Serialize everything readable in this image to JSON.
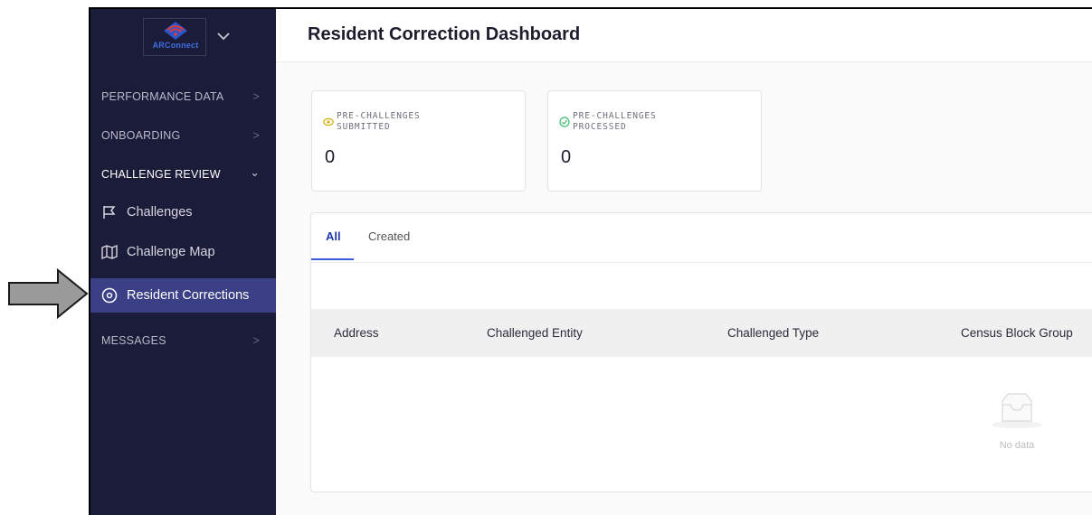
{
  "logo": {
    "text": "ARConnect"
  },
  "sidebar": {
    "sections": {
      "performance": {
        "label": "PERFORMANCE DATA",
        "chevron": ">"
      },
      "onboarding": {
        "label": "ONBOARDING",
        "chevron": ">"
      },
      "challenge_review": {
        "label": "CHALLENGE REVIEW",
        "chevron": "⌄"
      },
      "messages": {
        "label": "MESSAGES",
        "chevron": ">"
      }
    },
    "items": [
      {
        "label": "Challenges",
        "icon": "flag-icon"
      },
      {
        "label": "Challenge Map",
        "icon": "map-icon"
      },
      {
        "label": "Resident Corrections",
        "icon": "location-pin-icon",
        "active": true
      }
    ]
  },
  "page": {
    "title": "Resident Correction Dashboard"
  },
  "stats": [
    {
      "label_line1": "PRE-CHALLENGES",
      "label_line2": "SUBMITTED",
      "value": "0",
      "icon": "eye-icon",
      "icon_color": "#d4b10f"
    },
    {
      "label_line1": "PRE-CHALLENGES",
      "label_line2": "PROCESSED",
      "value": "0",
      "icon": "check-circle-icon",
      "icon_color": "#3fbf6f"
    }
  ],
  "tabs": [
    {
      "label": "All",
      "active": true
    },
    {
      "label": "Created",
      "active": false
    }
  ],
  "table": {
    "columns": [
      "Address",
      "Challenged Entity",
      "Challenged Type",
      "Census Block Group"
    ],
    "empty_text": "No data"
  },
  "colors": {
    "sidebar_bg": "#1b1b3a",
    "active_item": "#3b3f86",
    "accent": "#3b5bdb"
  }
}
